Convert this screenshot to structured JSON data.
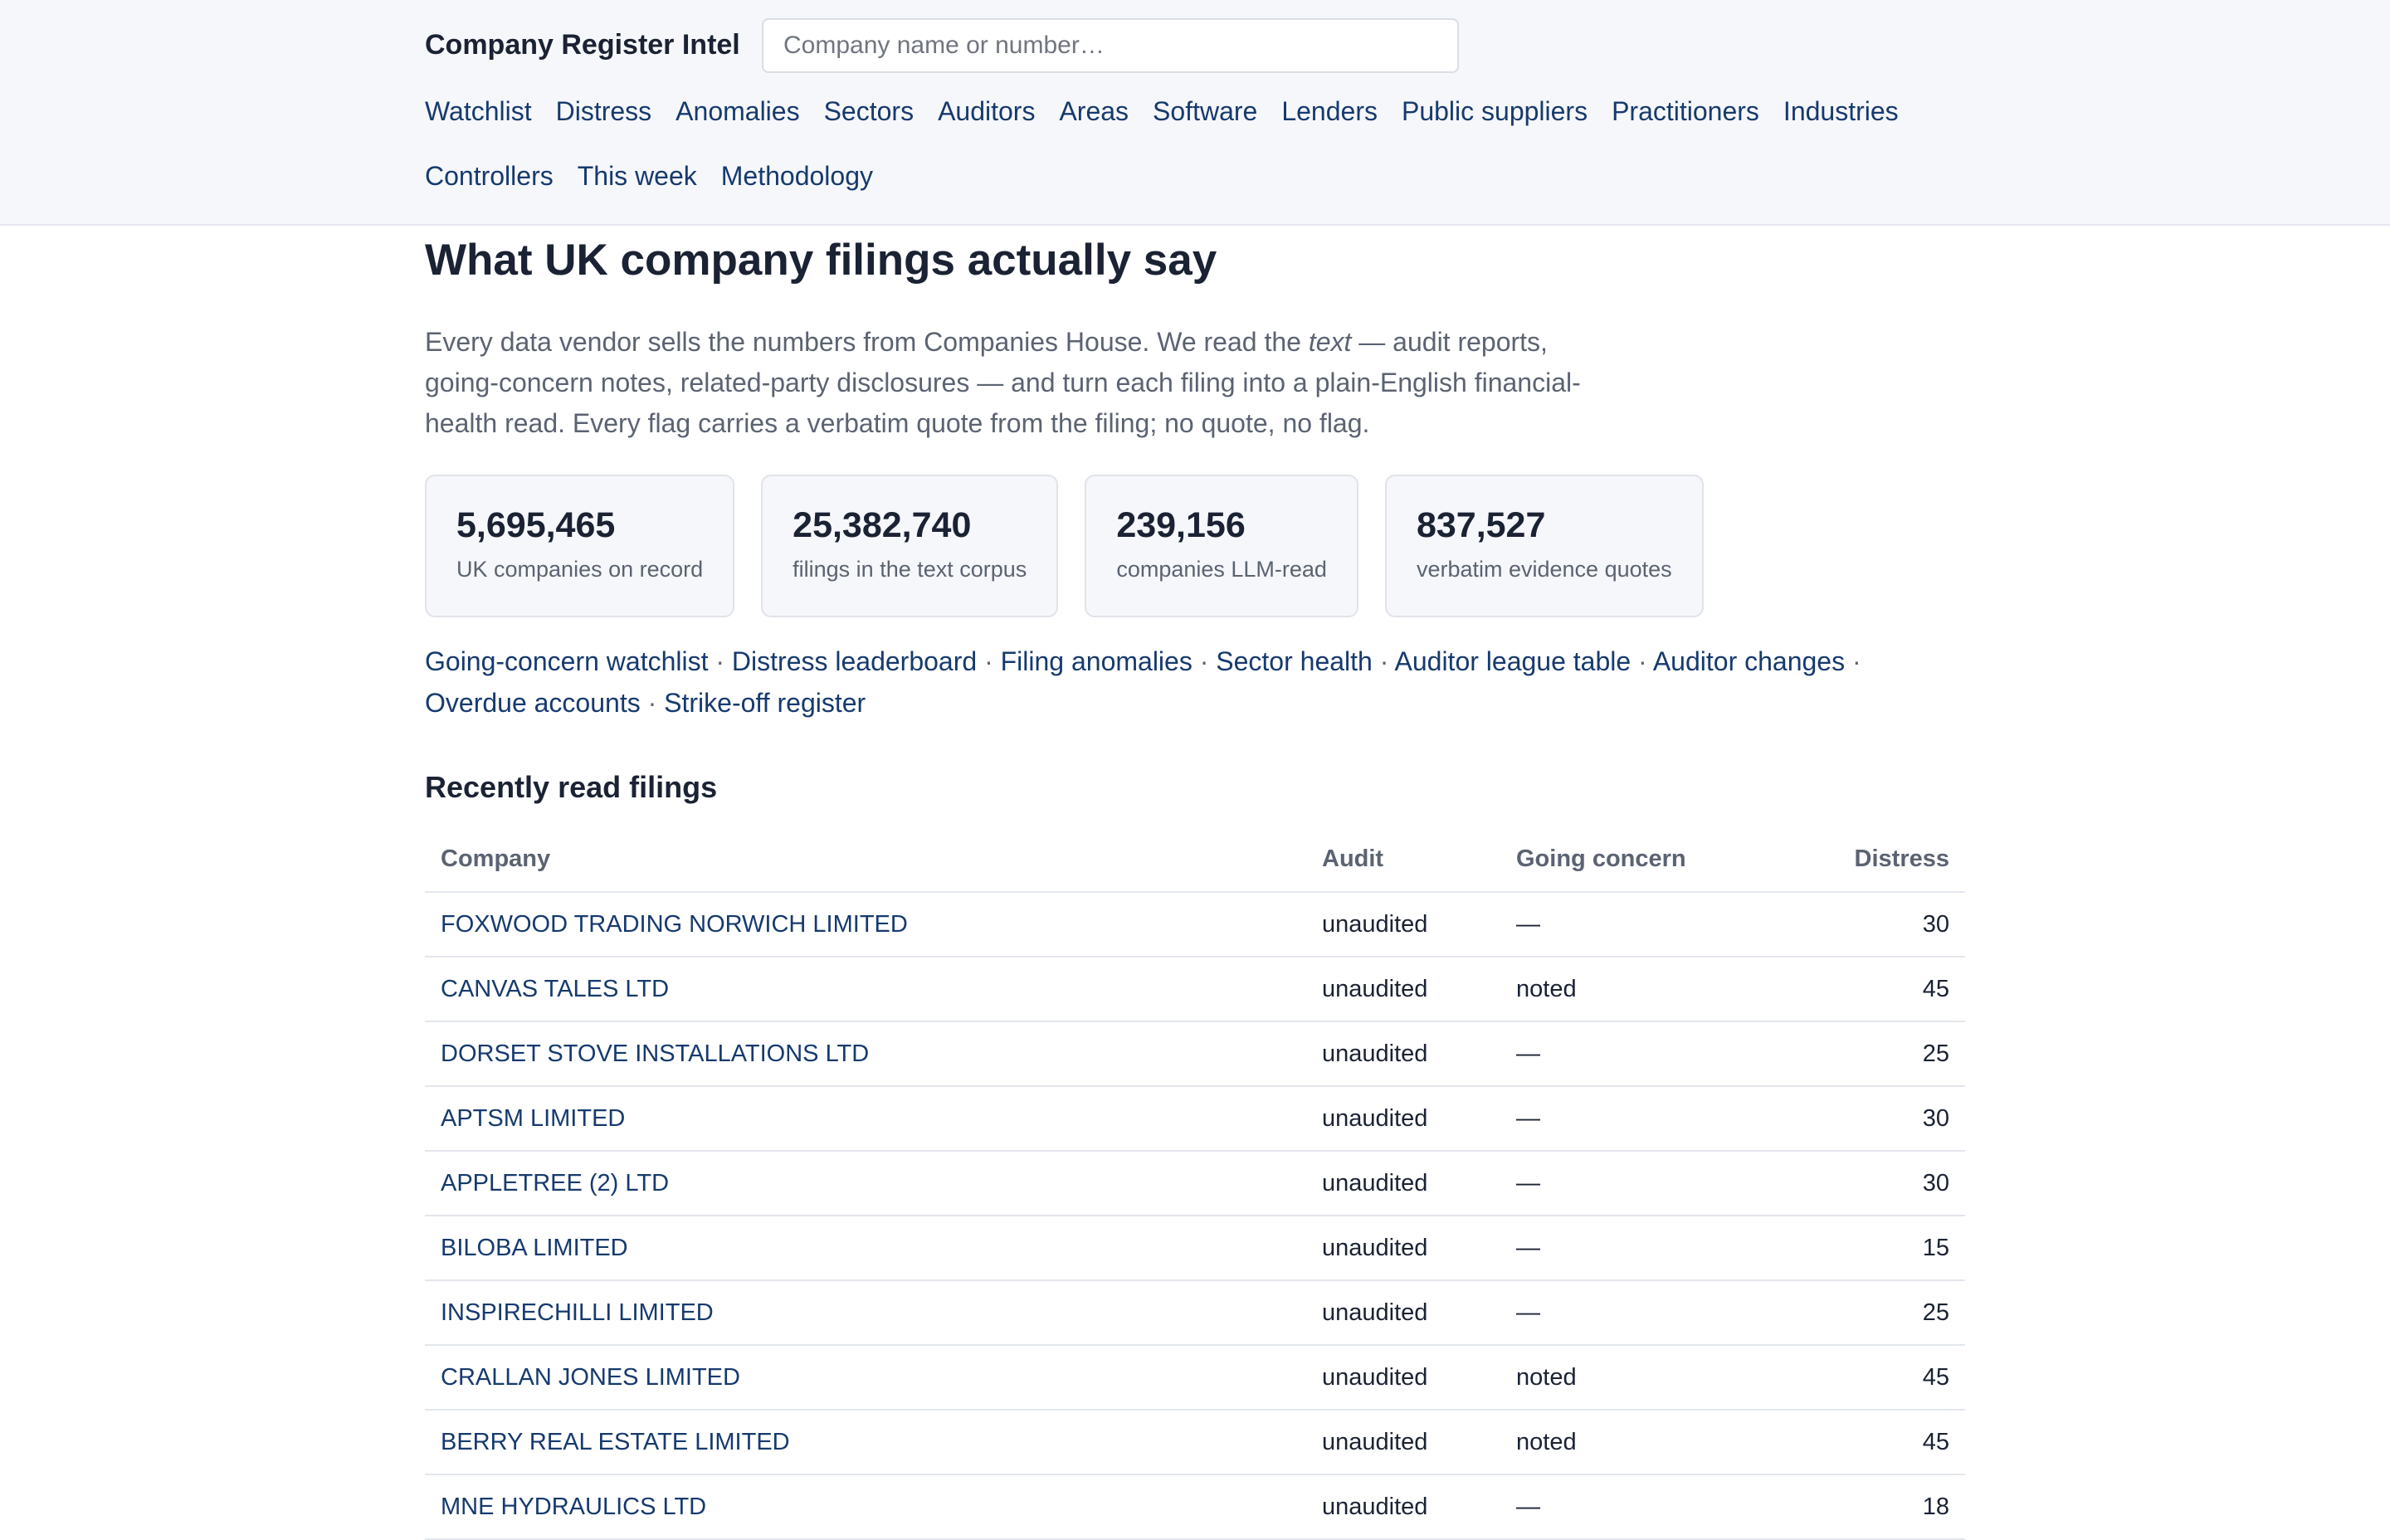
{
  "header": {
    "brand": "Company Register Intel",
    "search_placeholder": "Company name or number…",
    "nav": [
      "Watchlist",
      "Distress",
      "Anomalies",
      "Sectors",
      "Auditors",
      "Areas",
      "Software",
      "Lenders",
      "Public suppliers",
      "Practitioners",
      "Industries",
      "Controllers",
      "This week",
      "Methodology"
    ]
  },
  "main": {
    "title": "What UK company filings actually say",
    "intro_before": "Every data vendor sells the numbers from Companies House. We read the ",
    "intro_em": "text",
    "intro_after": " — audit reports, going-concern notes, related-party disclosures — and turn each filing into a plain-English financial-health read. Every flag carries a verbatim quote from the filing; no quote, no flag.",
    "stats": [
      {
        "value": "5,695,465",
        "label": "UK companies on record"
      },
      {
        "value": "25,382,740",
        "label": "filings in the text corpus"
      },
      {
        "value": "239,156",
        "label": "companies LLM-read"
      },
      {
        "value": "837,527",
        "label": "verbatim evidence quotes"
      }
    ],
    "quicklinks": {
      "separator": " · ",
      "items": [
        "Going-concern watchlist",
        "Distress leaderboard",
        "Filing anomalies",
        "Sector health",
        "Auditor league table",
        "Auditor changes",
        "Overdue accounts",
        "Strike-off register"
      ]
    },
    "recent": {
      "heading": "Recently read filings",
      "columns": [
        "Company",
        "Audit",
        "Going concern",
        "Distress"
      ],
      "rows": [
        [
          "FOXWOOD TRADING NORWICH LIMITED",
          "unaudited",
          "—",
          "30"
        ],
        [
          "CANVAS TALES LTD",
          "unaudited",
          "noted",
          "45"
        ],
        [
          "DORSET STOVE INSTALLATIONS LTD",
          "unaudited",
          "—",
          "25"
        ],
        [
          "APTSM LIMITED",
          "unaudited",
          "—",
          "30"
        ],
        [
          "APPLETREE (2) LTD",
          "unaudited",
          "—",
          "30"
        ],
        [
          "BILOBA LIMITED",
          "unaudited",
          "—",
          "15"
        ],
        [
          "INSPIRECHILLI LIMITED",
          "unaudited",
          "—",
          "25"
        ],
        [
          "CRALLAN JONES LIMITED",
          "unaudited",
          "noted",
          "45"
        ],
        [
          "BERRY REAL ESTATE LIMITED",
          "unaudited",
          "noted",
          "45"
        ],
        [
          "MNE HYDRAULICS LTD",
          "unaudited",
          "—",
          "18"
        ]
      ]
    }
  }
}
